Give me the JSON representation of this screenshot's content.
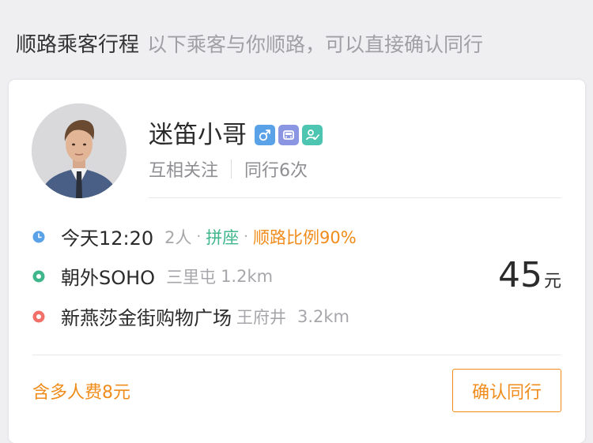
{
  "header": {
    "title": "顺路乘客行程",
    "subtitle": "以下乘客与你顺路，可以直接确认同行"
  },
  "passenger": {
    "name": "迷笛小哥",
    "badges": {
      "gender_icon": "male-icon",
      "car_icon": "car-icon",
      "verified_icon": "verified-user-icon"
    },
    "relation": "互相关注",
    "trips_together": "同行6次"
  },
  "trip": {
    "time": "今天12:20",
    "people": "2人",
    "mode": "拼座",
    "match_ratio": "顺路比例90%",
    "origin": {
      "name": "朝外SOHO",
      "district": "三里屯",
      "distance": "1.2km"
    },
    "destination": {
      "name": "新燕莎金街购物广场",
      "district": "王府井",
      "distance": "3.2km"
    },
    "separator": "·"
  },
  "price": {
    "amount": "45",
    "unit": "元"
  },
  "footer": {
    "extra_fee": "含多人费8元",
    "confirm_label": "确认同行"
  },
  "colors": {
    "accent_orange": "#f08c1b",
    "carpool_green": "#3fb68b",
    "time_dot_blue": "#5aa2e8",
    "origin_dot_green": "#3fb68b",
    "dest_dot_red": "#f2706a"
  }
}
